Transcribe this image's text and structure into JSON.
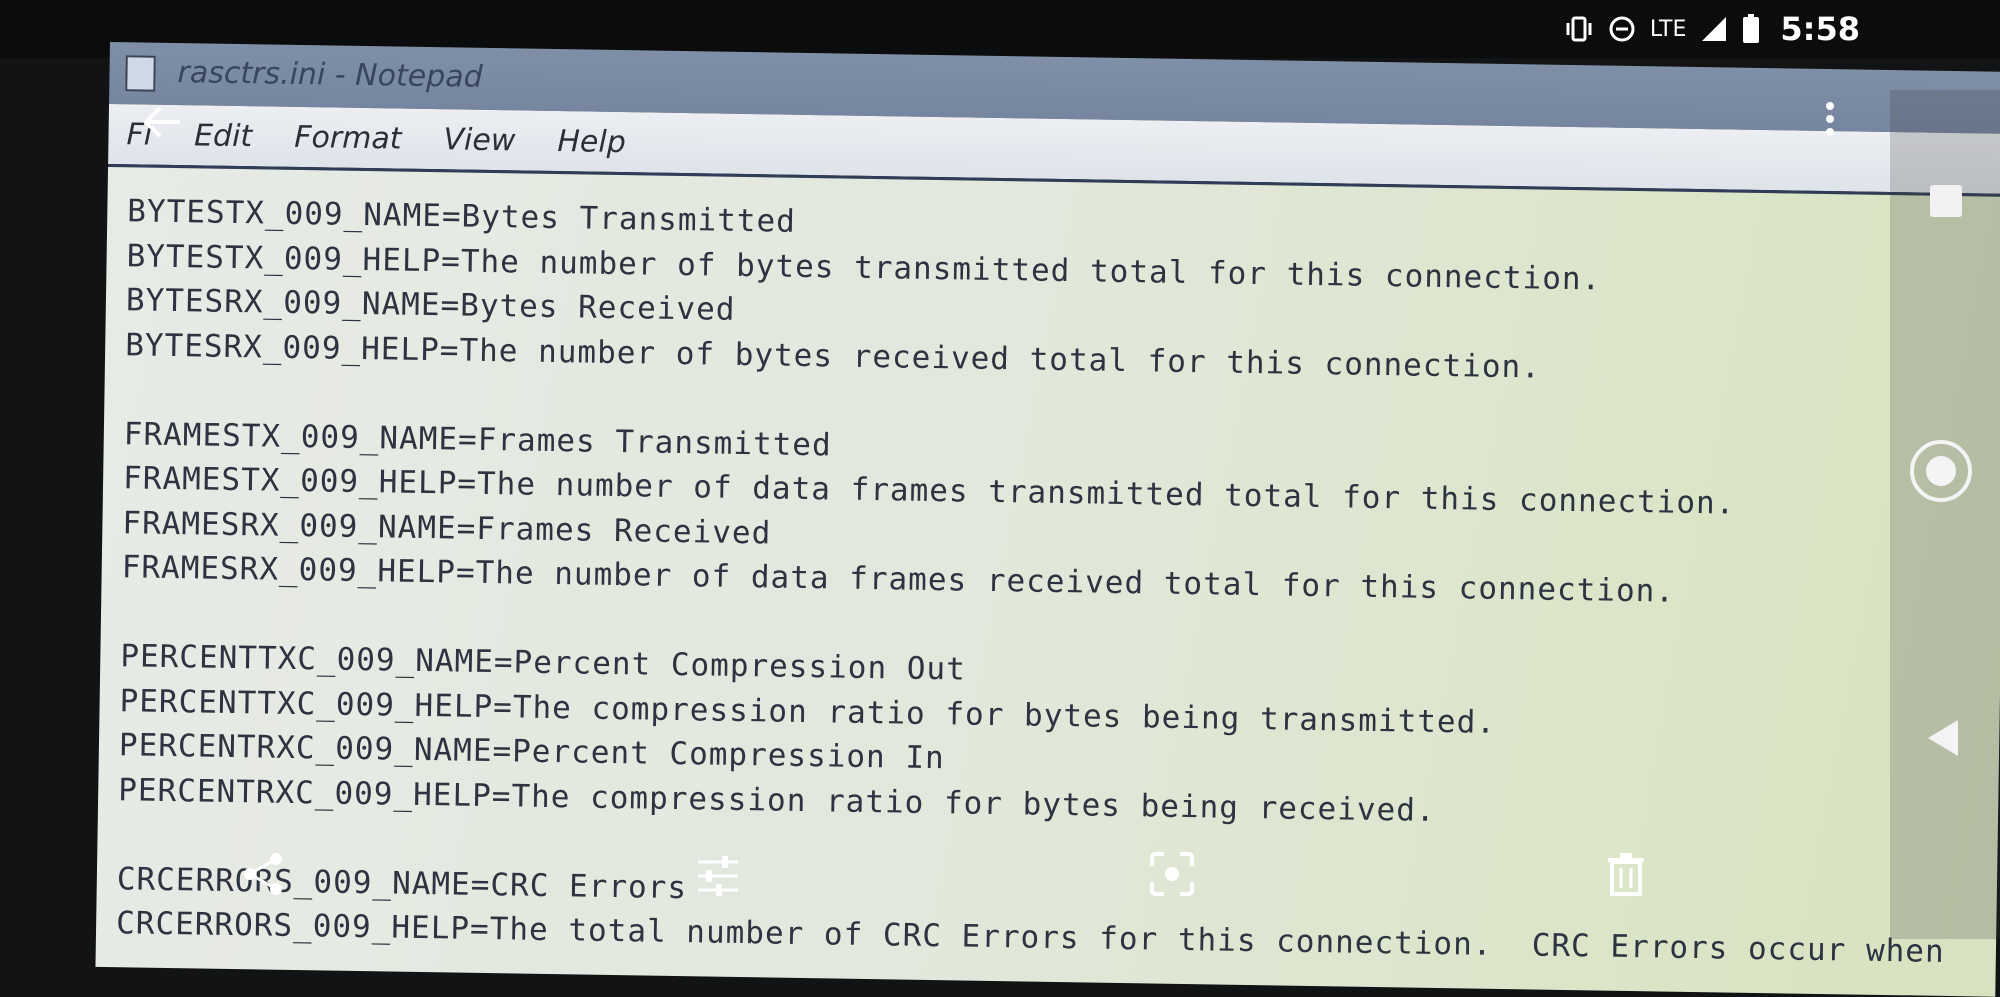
{
  "status_bar": {
    "network": "LTE",
    "time": "5:58",
    "icons": [
      "vibrate-icon",
      "do-not-disturb-icon",
      "signal-icon",
      "battery-icon"
    ]
  },
  "window": {
    "title": "rasctrs.ini - Notepad"
  },
  "menu": {
    "file": "Fi",
    "edit": "Edit",
    "format": "Format",
    "view": "View",
    "help": "Help"
  },
  "editor": {
    "lines": [
      "BYTESTX_009_NAME=Bytes Transmitted",
      "BYTESTX_009_HELP=The number of bytes transmitted total for this connection.",
      "BYTESRX_009_NAME=Bytes Received",
      "BYTESRX_009_HELP=The number of bytes received total for this connection.",
      "",
      "FRAMESTX_009_NAME=Frames Transmitted",
      "FRAMESTX_009_HELP=The number of data frames transmitted total for this connection.",
      "FRAMESRX_009_NAME=Frames Received",
      "FRAMESRX_009_HELP=The number of data frames received total for this connection.",
      "",
      "PERCENTTXC_009_NAME=Percent Compression Out",
      "PERCENTTXC_009_HELP=The compression ratio for bytes being transmitted.",
      "PERCENTRXC_009_NAME=Percent Compression In",
      "PERCENTRXC_009_HELP=The compression ratio for bytes being received.",
      "",
      "CRCERRORS_009_NAME=CRC Errors",
      "CRCERRORS_009_HELP=The total number of CRC Errors for this connection.  CRC Errors occur when"
    ]
  },
  "viewer_actions": [
    "share-icon",
    "edit-icon",
    "lens-icon",
    "delete-icon"
  ],
  "colors": {
    "status_bar": "#0b0c0d",
    "title_bar": "#7a8aa2",
    "menu_bar": "#e6e9ee",
    "editor_bg": "#e2e8dc",
    "editor_text": "#2d3340",
    "overlay_icons": "#ffffff"
  }
}
